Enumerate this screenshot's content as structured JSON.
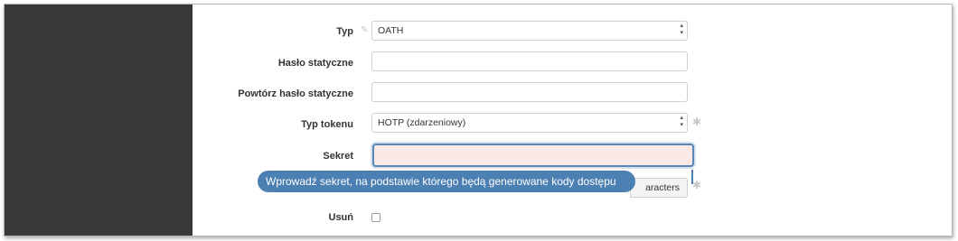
{
  "form": {
    "type": {
      "label": "Typ",
      "value": "OATH"
    },
    "static_password": {
      "label": "Hasło statyczne",
      "value": ""
    },
    "repeat_static_password": {
      "label": "Powtórz hasło statyczne",
      "value": ""
    },
    "token_type": {
      "label": "Typ tokenu",
      "value": "HOTP (zdarzeniowy)"
    },
    "secret": {
      "label": "Sekret",
      "value": ""
    },
    "generate_button_label": "aracters",
    "delete": {
      "label": "Usuń",
      "checked": false
    }
  },
  "tooltip": "Wprowadź sekret, na podstawie którego będą generowane kody dostępu",
  "colors": {
    "sidebar": "#383838",
    "accent": "#4c7fb2",
    "secret_field_bg": "#fbe9e6"
  },
  "icons": {
    "edit": "edit-icon",
    "required": "asterisk-icon"
  }
}
